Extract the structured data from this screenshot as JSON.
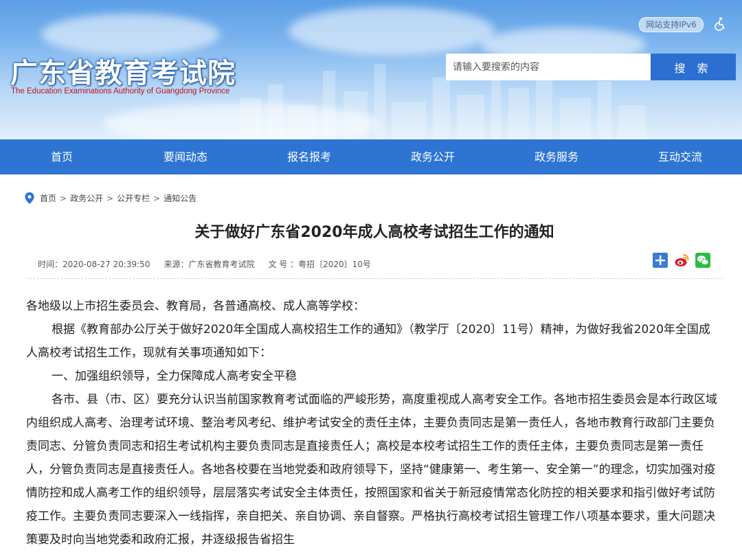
{
  "header": {
    "title": "广东省教育考试院",
    "subtitle": "The Education Examinations Authority of Guangdong Province",
    "ipv6_label": "网站支持IPv6",
    "search_placeholder": "请输入要搜索的内容",
    "search_button": "搜 索"
  },
  "nav": {
    "items": [
      "首页",
      "要闻动态",
      "报名报考",
      "政务公开",
      "政务服务",
      "互动交流"
    ]
  },
  "breadcrumb": {
    "items": [
      "首页",
      "政务公开",
      "公开专栏",
      "通知公告"
    ],
    "separator": ">"
  },
  "article": {
    "title": "关于做好广东省2020年成人高校考试招生工作的通知",
    "time": "时间：2020-08-27 20:39:50",
    "source": "来源：广东省教育考试院",
    "doc_no": "文 号 ：粤招〔2020〕10号",
    "paragraphs": [
      "各地级以上市招生委员会、教育局，各普通高校、成人高等学校：",
      "根据《教育部办公厅关于做好2020年全国成人高校招生工作的通知》（教学厅〔2020〕11号）精神，为做好我省2020年全国成人高校考试招生工作，现就有关事项通知如下：",
      "一、加强组织领导，全力保障成人高考安全平稳",
      "各市、县（市、区）要充分认识当前国家教育考试面临的严峻形势，高度重视成人高考安全工作。各地市招生委员会是本行政区域内组织成人高考、治理考试环境、整治考风考纪、维护考试安全的责任主体，主要负责同志是第一责任人，各地市教育行政部门主要负责同志、分管负责同志和招生考试机构主要负责同志是直接责任人；高校是本校考试招生工作的责任主体，主要负责同志是第一责任人，分管负责同志是直接责任人。各地各校要在当地党委和政府领导下，坚持“健康第一、考生第一、安全第一”的理念，切实加强对疫情防控和成人高考工作的组织领导，层层落实考试安全主体责任，按照国家和省关于新冠疫情常态化防控的相关要求和指引做好考试防疫工作。主要负责同志要深入一线指挥，亲自把关、亲自协调、亲自督察。严格执行高校考试招生管理工作八项基本要求，重大问题决策要及时向当地党委和政府汇报，并逐级报告省招生"
    ]
  },
  "colors": {
    "nav_bg": "#2d74d3",
    "search_button_bg": "#2c6fd1",
    "subtitle": "#c0141a"
  },
  "icons": {
    "accessibility": "accessibility-icon",
    "location": "location-pin-icon",
    "share": [
      "share-plus-icon",
      "weibo-icon",
      "wechat-icon"
    ]
  }
}
